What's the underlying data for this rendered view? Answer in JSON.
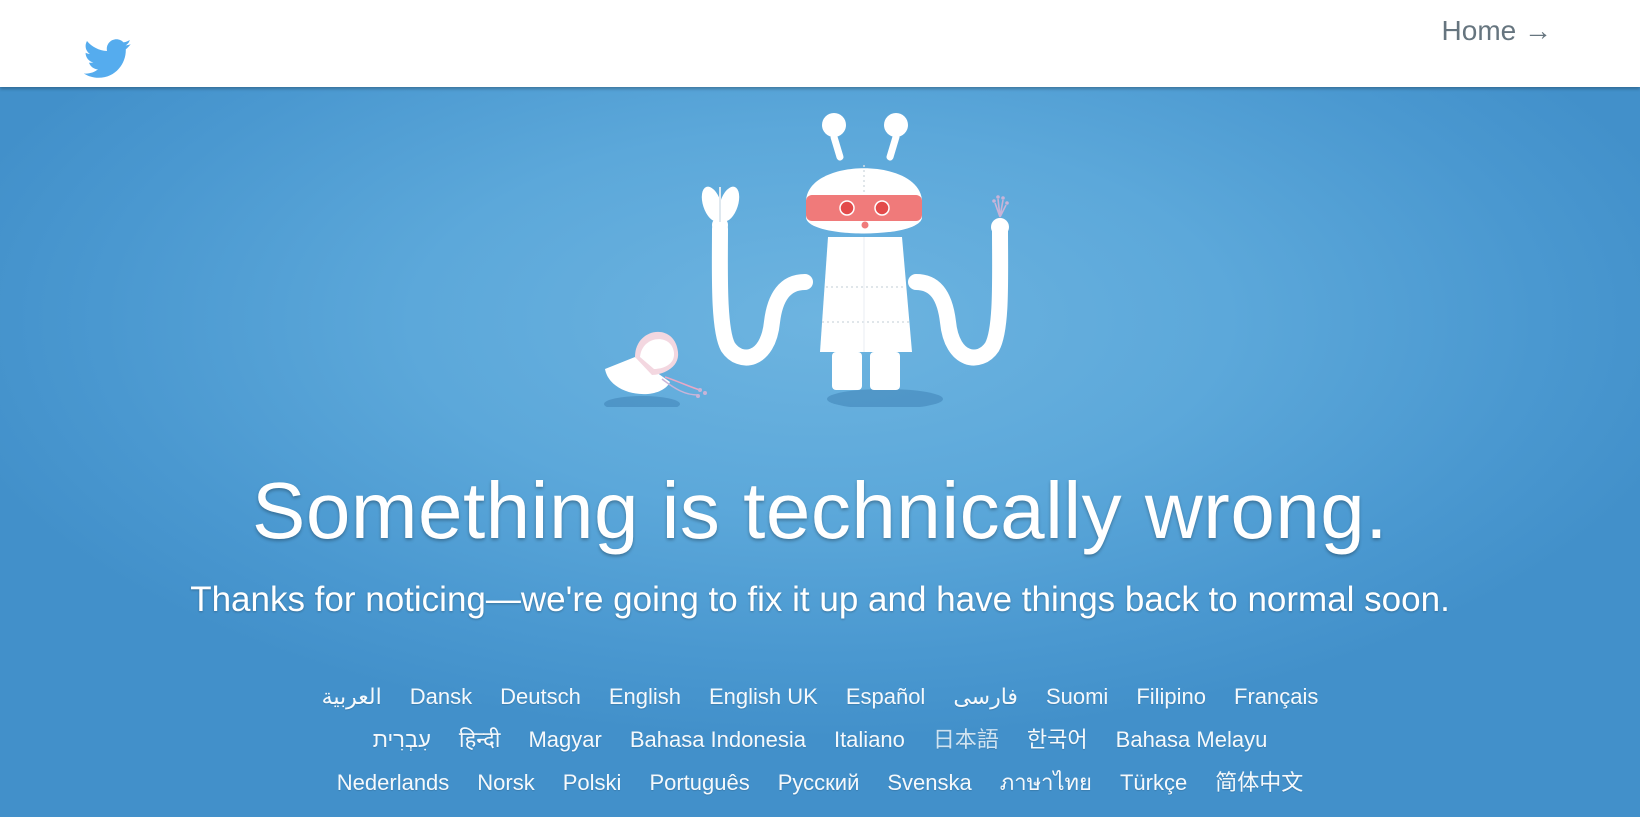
{
  "colors": {
    "header_bg": "#ffffff",
    "hero_bg": "#55a4d8",
    "brand_blue": "#55acee",
    "home_link": "#66757f",
    "visor_red": "#f06a6a"
  },
  "header": {
    "logo_icon": "twitter-bird-icon",
    "home_link": "Home →"
  },
  "illustration": {
    "name": "broken-robot-illustration"
  },
  "main": {
    "headline": "Something is technically wrong.",
    "subhead": "Thanks for noticing—we're going to fix it up and have things back to normal soon."
  },
  "languages": {
    "rows": [
      [
        "العربية",
        "Dansk",
        "Deutsch",
        "English",
        "English UK",
        "Español",
        "فارسی",
        "Suomi",
        "Filipino",
        "Français"
      ],
      [
        "עִבְרִית",
        "हिन्दी",
        "Magyar",
        "Bahasa Indonesia",
        "Italiano",
        "日本語",
        "한국어",
        "Bahasa Melayu"
      ],
      [
        "Nederlands",
        "Norsk",
        "Polski",
        "Português",
        "Русский",
        "Svenska",
        "ภาษาไทย",
        "Türkçe",
        "简体中文"
      ]
    ]
  }
}
